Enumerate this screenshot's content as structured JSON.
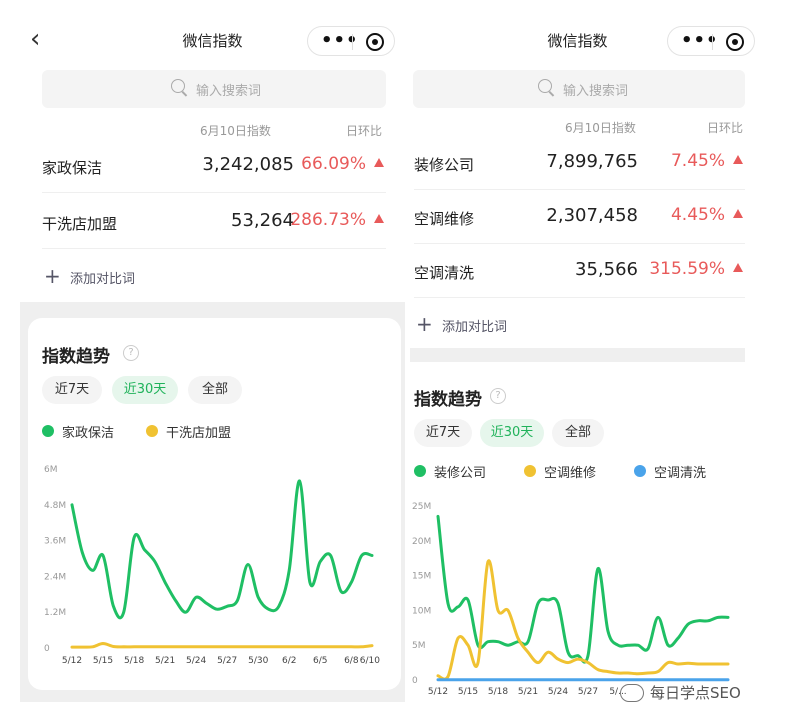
{
  "left": {
    "nav": {
      "title": "微信指数",
      "back": "‹"
    },
    "search": {
      "placeholder": "输入搜索词"
    },
    "header": {
      "date_index": "6月10日指数",
      "ratio": "日环比"
    },
    "rows": [
      {
        "keyword": "家政保洁",
        "value": "3,242,085",
        "change": "66.09%"
      },
      {
        "keyword": "干洗店加盟",
        "value": "53,264",
        "change": "286.73%"
      }
    ],
    "add_label": "添加对比词",
    "trend": {
      "title": "指数趋势",
      "help": "?"
    },
    "ranges": [
      "近7天",
      "近30天",
      "全部"
    ],
    "legend": [
      {
        "name": "家政保洁",
        "color": "#1fbf64"
      },
      {
        "name": "干洗店加盟",
        "color": "#f0c232"
      }
    ]
  },
  "right": {
    "nav": {
      "title": "微信指数"
    },
    "search": {
      "placeholder": "输入搜索词"
    },
    "header": {
      "date_index": "6月10日指数",
      "ratio": "日环比"
    },
    "rows": [
      {
        "keyword": "装修公司",
        "value": "7,899,765",
        "change": "7.45%"
      },
      {
        "keyword": "空调维修",
        "value": "2,307,458",
        "change": "4.45%"
      },
      {
        "keyword": "空调清洗",
        "value": "35,566",
        "change": "315.59%"
      }
    ],
    "add_label": "添加对比词",
    "trend": {
      "title": "指数趋势",
      "help": "?"
    },
    "ranges": [
      "近7天",
      "近30天",
      "全部"
    ],
    "legend": [
      {
        "name": "装修公司",
        "color": "#1fbf64"
      },
      {
        "name": "空调维修",
        "color": "#f0c232"
      },
      {
        "name": "空调清洗",
        "color": "#4aa3ea"
      }
    ]
  },
  "watermark": "每日学点SEO",
  "chart_data": [
    {
      "type": "line",
      "ylim": [
        0,
        6
      ],
      "yticks": [
        "6M",
        "4.8M",
        "3.6M",
        "2.4M",
        "1.2M",
        "0"
      ],
      "ytick_values": [
        6,
        4.8,
        3.6,
        2.4,
        1.2,
        0
      ],
      "xticks": [
        "5/12",
        "5/15",
        "5/18",
        "5/21",
        "5/24",
        "5/27",
        "5/30",
        "6/2",
        "6/5",
        "6/8",
        "6/10"
      ],
      "xtick_index": [
        0,
        3,
        6,
        9,
        12,
        15,
        18,
        21,
        24,
        27,
        29
      ],
      "series": [
        {
          "name": "家政保洁",
          "color": "#1fbf64",
          "values": [
            4.8,
            3.2,
            2.6,
            3.1,
            1.4,
            1.2,
            3.7,
            3.3,
            2.9,
            2.2,
            1.6,
            1.2,
            1.7,
            1.5,
            1.3,
            1.4,
            1.6,
            2.8,
            1.7,
            1.3,
            1.4,
            2.6,
            5.6,
            2.2,
            2.9,
            3.1,
            1.9,
            2.2,
            3.1,
            3.1
          ]
        },
        {
          "name": "干洗店加盟",
          "color": "#f0c232",
          "values": [
            0.03,
            0.03,
            0.04,
            0.15,
            0.05,
            0.04,
            0.04,
            0.04,
            0.04,
            0.04,
            0.04,
            0.04,
            0.04,
            0.04,
            0.04,
            0.04,
            0.04,
            0.04,
            0.04,
            0.04,
            0.04,
            0.04,
            0.04,
            0.04,
            0.04,
            0.04,
            0.04,
            0.04,
            0.04,
            0.08
          ]
        }
      ]
    },
    {
      "type": "line",
      "ylim": [
        0,
        25
      ],
      "yticks": [
        "25M",
        "20M",
        "15M",
        "10M",
        "5M",
        "0"
      ],
      "ytick_values": [
        25,
        20,
        15,
        10,
        5,
        0
      ],
      "xticks": [
        "5/12",
        "5/15",
        "5/18",
        "5/21",
        "5/24",
        "5/27",
        "5/..."
      ],
      "xtick_index": [
        0,
        3,
        6,
        9,
        12,
        15,
        18
      ],
      "series": [
        {
          "name": "装修公司",
          "color": "#1fbf64",
          "values": [
            23.5,
            11,
            10.5,
            11.5,
            5,
            5.5,
            5.5,
            5,
            5.5,
            5.5,
            11,
            11.5,
            11,
            4,
            3.5,
            3.5,
            16,
            7,
            5,
            5,
            5,
            4.5,
            9,
            5,
            6,
            8,
            8.5,
            8.5,
            9,
            9
          ]
        },
        {
          "name": "空调维修",
          "color": "#f0c232",
          "values": [
            0.6,
            0.5,
            6,
            5,
            2.5,
            17,
            10,
            10,
            6,
            4,
            2.5,
            4,
            3,
            2.5,
            3,
            2.5,
            1.5,
            1.2,
            1.0,
            1.0,
            0.9,
            1.0,
            1.2,
            2.5,
            2.3,
            2.4,
            2.3,
            2.3,
            2.3,
            2.3
          ]
        },
        {
          "name": "空调清洗",
          "color": "#4aa3ea",
          "values": [
            0.05,
            0.05,
            0.05,
            0.05,
            0.05,
            0.05,
            0.05,
            0.05,
            0.05,
            0.05,
            0.05,
            0.05,
            0.05,
            0.05,
            0.05,
            0.05,
            0.05,
            0.05,
            0.05,
            0.05,
            0.05,
            0.05,
            0.05,
            0.05,
            0.05,
            0.05,
            0.05,
            0.05,
            0.05,
            0.05
          ]
        }
      ]
    }
  ]
}
